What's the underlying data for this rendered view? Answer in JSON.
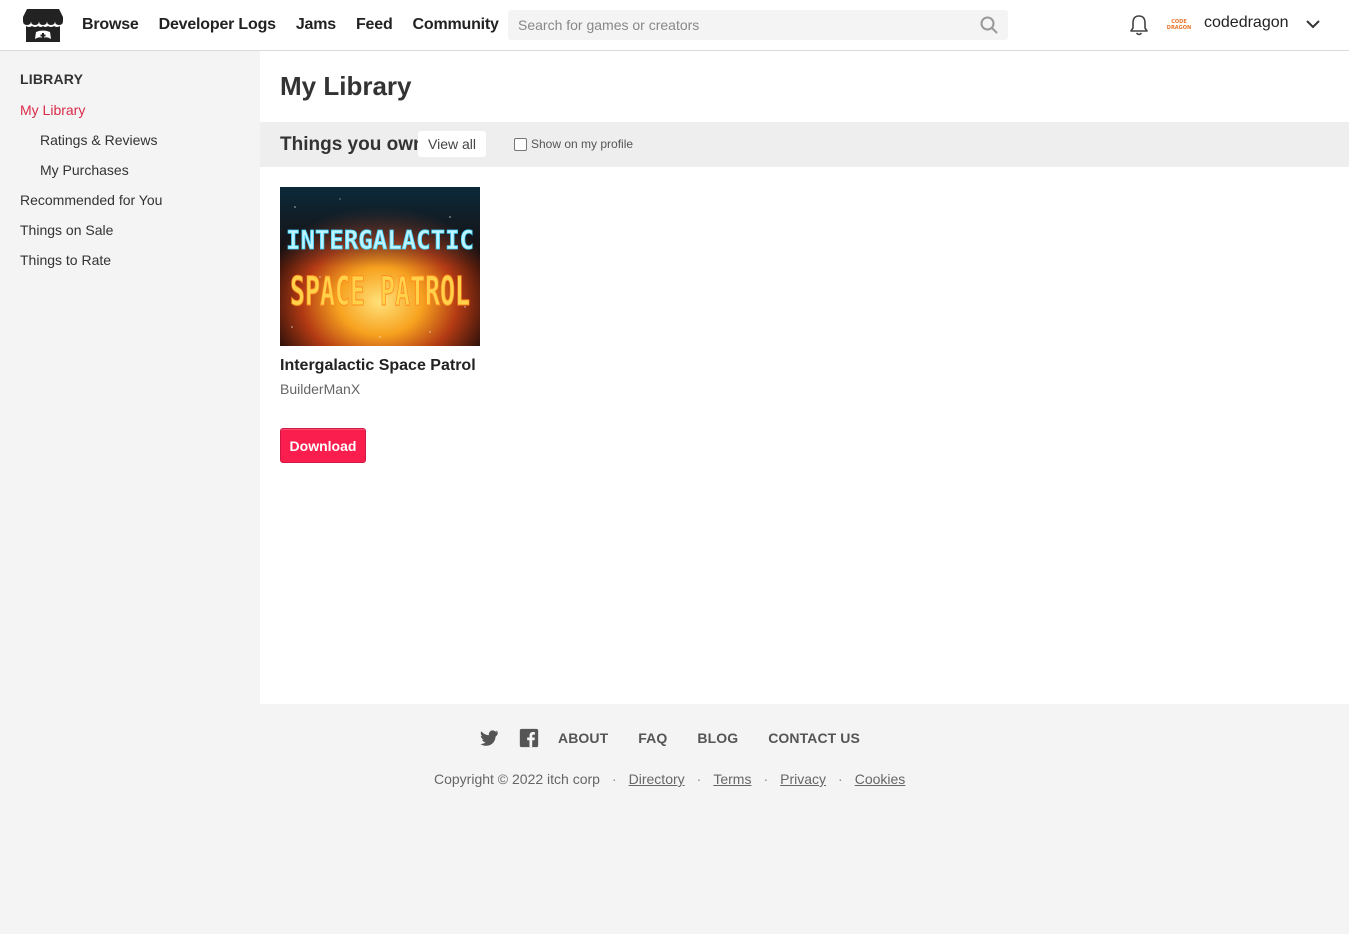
{
  "header": {
    "nav": [
      "Browse",
      "Developer Logs",
      "Jams",
      "Feed",
      "Community"
    ],
    "search_placeholder": "Search for games or creators",
    "avatar_text": [
      "CODE",
      "DRAGON"
    ],
    "username": "codedragon"
  },
  "sidebar": {
    "heading": "LIBRARY",
    "items": [
      {
        "label": "My Library",
        "active": true
      },
      {
        "label": "Ratings & Reviews"
      },
      {
        "label": "My Purchases"
      },
      {
        "label": "Recommended for You"
      },
      {
        "label": "Things on Sale"
      },
      {
        "label": "Things to Rate"
      }
    ]
  },
  "main": {
    "title": "My Library",
    "section_title": "Things you own",
    "view_all": "View all",
    "show_on_profile": "Show on my profile",
    "show_on_profile_checked": false,
    "game": {
      "cover_line1": "INTERGALACTIC",
      "cover_line2": "SPACE PATROL",
      "title": "Intergalactic Space Patrol",
      "author": "BuilderManX",
      "button": "Download"
    }
  },
  "footer": {
    "links": [
      "ABOUT",
      "FAQ",
      "BLOG",
      "CONTACT US"
    ],
    "copyright": "Copyright © 2022 itch corp",
    "legal": [
      "Directory",
      "Terms",
      "Privacy",
      "Cookies"
    ],
    "separator": "·"
  },
  "colors": {
    "accent": "#da2c49",
    "download_button": "#fa1e4e"
  }
}
